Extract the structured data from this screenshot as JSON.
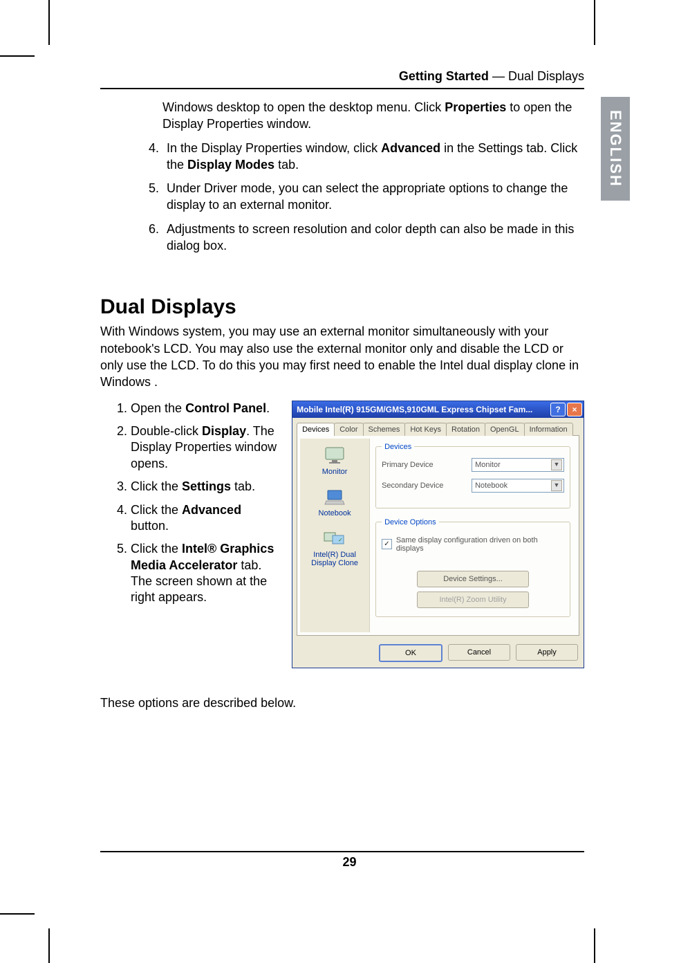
{
  "header": {
    "section": "Getting Started",
    "separator": " — ",
    "topic": "Dual Displays"
  },
  "lang_tab": "ENGLISH",
  "continued_list_start": 4,
  "continued_list": [
    {
      "pre": "Windows desktop to open the desktop menu. Click ",
      "b1": "Properties",
      "post": " to open the Display Properties window.",
      "num_override": ""
    },
    {
      "pre": "In the Display Properties window, click ",
      "b1": "Advanced",
      "mid": " in the Settings tab. Click the ",
      "b2": "Display Modes",
      "post": " tab."
    },
    {
      "pre": "Under Driver mode, you can select the appropriate options to change the display to an external monitor."
    },
    {
      "pre": "Adjustments to screen resolution and color depth can also be made in this dialog box."
    }
  ],
  "section_title": "Dual Displays",
  "intro": "With Windows system, you may use an external monitor simultaneously with your notebook's LCD. You may also use the external monitor only and disable the LCD or only use the LCD. To do this you may first need to enable the Intel dual display clone in Windows .",
  "steps": [
    {
      "pre": "Open the ",
      "b1": "Control Panel",
      "post": "."
    },
    {
      "pre": "Double-click ",
      "b1": "Display",
      "post": ". The Display Properties window opens."
    },
    {
      "pre": "Click the ",
      "b1": "Settings",
      "post": " tab."
    },
    {
      "pre": "Click the ",
      "b1": "Advanced",
      "post": " button."
    },
    {
      "pre": "Click the ",
      "b1": "Intel® Graphics Media Accelerator",
      "post": " tab. The screen shown at the right appears."
    }
  ],
  "dialog": {
    "title": "Mobile Intel(R) 915GM/GMS,910GML Express Chipset Fam...",
    "tabs": [
      "Devices",
      "Color",
      "Schemes",
      "Hot Keys",
      "Rotation",
      "OpenGL",
      "Information"
    ],
    "active_tab": 0,
    "side_items": [
      "Monitor",
      "Notebook",
      "Intel(R) Dual Display Clone"
    ],
    "devices_legend": "Devices",
    "primary_label": "Primary Device",
    "primary_value": "Monitor",
    "secondary_label": "Secondary Device",
    "secondary_value": "Notebook",
    "options_legend": "Device Options",
    "checkbox_label": "Same display configuration driven on both displays",
    "checkbox_checked": true,
    "btn_device_settings": "Device Settings...",
    "btn_zoom": "Intel(R) Zoom Utility",
    "btn_ok": "OK",
    "btn_cancel": "Cancel",
    "btn_apply": "Apply"
  },
  "below_note": "These options are described below.",
  "page_number": "29"
}
